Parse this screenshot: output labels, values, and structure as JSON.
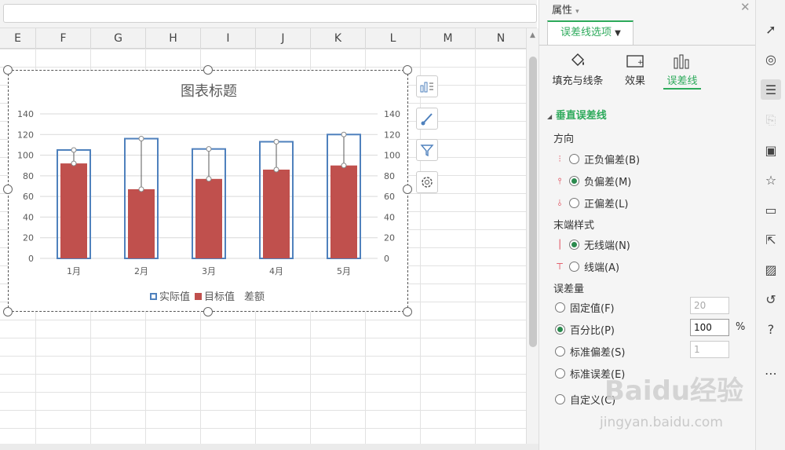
{
  "columns": [
    "E",
    "F",
    "G",
    "H",
    "I",
    "J",
    "K",
    "L",
    "M",
    "N"
  ],
  "chart": {
    "title": "图表标题",
    "legend": {
      "actual": "实际值",
      "target": "目标值",
      "diff": "差额"
    },
    "colors": {
      "actual": "#4f81bd",
      "target": "#c0504d"
    }
  },
  "chart_data": {
    "type": "bar",
    "title": "图表标题",
    "categories": [
      "1月",
      "2月",
      "3月",
      "4月",
      "5月"
    ],
    "series": [
      {
        "name": "实际值",
        "values": [
          105,
          116,
          106,
          113,
          120
        ]
      },
      {
        "name": "目标值",
        "values": [
          92,
          67,
          77,
          86,
          90
        ]
      },
      {
        "name": "差额",
        "values": [
          13,
          49,
          29,
          27,
          30
        ]
      }
    ],
    "ylim": [
      0,
      140
    ],
    "yticks": [
      "0",
      "20",
      "40",
      "60",
      "80",
      "100",
      "120",
      "140"
    ],
    "secondary_axis": true,
    "grid": true,
    "legend_position": "bottom"
  },
  "panel": {
    "title": "属性",
    "tab": "误差线选项",
    "subtabs": [
      "填充与线条",
      "效果",
      "误差线"
    ],
    "section": "垂直误差线",
    "direction_label": "方向",
    "directions": [
      "正负偏差(B)",
      "负偏差(M)",
      "正偏差(L)"
    ],
    "endstyle_label": "末端样式",
    "endstyles": [
      "无线端(N)",
      "线端(A)"
    ],
    "amount_label": "误差量",
    "amounts": [
      "固定值(F)",
      "百分比(P)",
      "标准偏差(S)",
      "标准误差(E)",
      "自定义(C)"
    ],
    "fixed_value": "20",
    "percent_value": "100",
    "percent_unit": "%",
    "stddev_value": "1"
  },
  "watermark": {
    "brand": "Baidu经验",
    "url": "jingyan.baidu.com"
  }
}
